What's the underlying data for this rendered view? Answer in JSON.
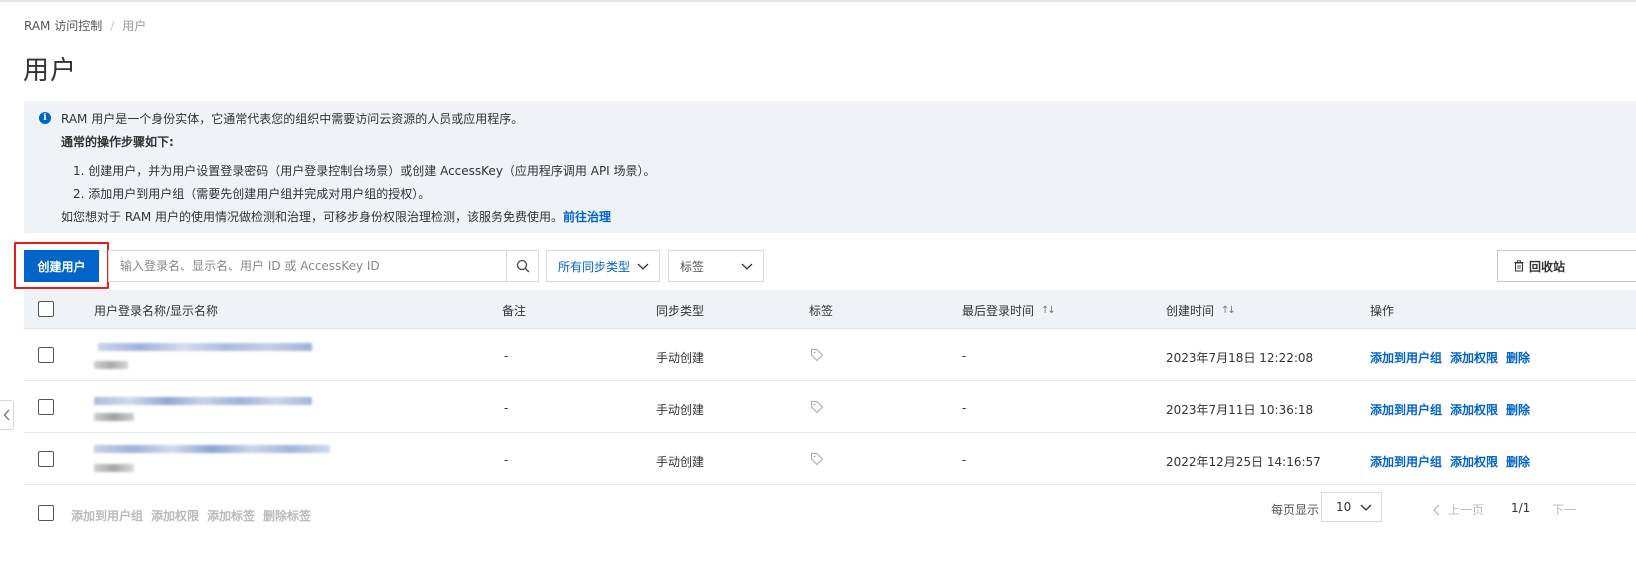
{
  "breadcrumb": {
    "root": "RAM 访问控制",
    "separator": "/",
    "current": "用户"
  },
  "page_title": "用户",
  "notice": {
    "line1": "RAM 用户是一个身份实体，它通常代表您的组织中需要访问云资源的人员或应用程序。",
    "line2": "通常的操作步骤如下:",
    "step1": "1. 创建用户，并为用户设置登录密码（用户登录控制台场景）或创建 AccessKey（应用程序调用 API 场景）。",
    "step2": "2. 添加用户到用户组（需要先创建用户组并完成对用户组的授权）。",
    "line5": "如您想对于 RAM 用户的使用情况做检测和治理，可移步身份权限治理检测，该服务免费使用。",
    "link": "前往治理"
  },
  "toolbar": {
    "create_label": "创建用户",
    "search_placeholder": "输入登录名、显示名、用户 ID 或 AccessKey ID",
    "sync_filter": "所有同步类型",
    "tag_filter": "标签",
    "recycle_label": "回收站"
  },
  "table": {
    "headers": {
      "name": "用户登录名称/显示名称",
      "note": "备注",
      "sync": "同步类型",
      "tag": "标签",
      "last_login": "最后登录时间",
      "created": "创建时间",
      "ops": "操作"
    },
    "rows": [
      {
        "note": "-",
        "sync": "手动创建",
        "last_login": "-",
        "created": "2023年7月18日 12:22:08"
      },
      {
        "note": "-",
        "sync": "手动创建",
        "last_login": "-",
        "created": "2023年7月11日 10:36:18"
      },
      {
        "note": "-",
        "sync": "手动创建",
        "last_login": "-",
        "created": "2022年12月25日 14:16:57"
      }
    ],
    "actions": {
      "add_group": "添加到用户组",
      "add_perm": "添加权限",
      "delete": "删除"
    }
  },
  "batch": {
    "add_group": "添加到用户组",
    "add_perm": "添加权限",
    "add_tag": "添加标签",
    "remove_tag": "删除标签"
  },
  "pagination": {
    "per_page_label": "每页显示",
    "per_page": "10",
    "prev": "上一页",
    "page": "1/1",
    "next": "下一"
  },
  "colors": {
    "primary": "#0064c8",
    "highlight": "#e02020",
    "notice_bg": "#eff2f7"
  }
}
